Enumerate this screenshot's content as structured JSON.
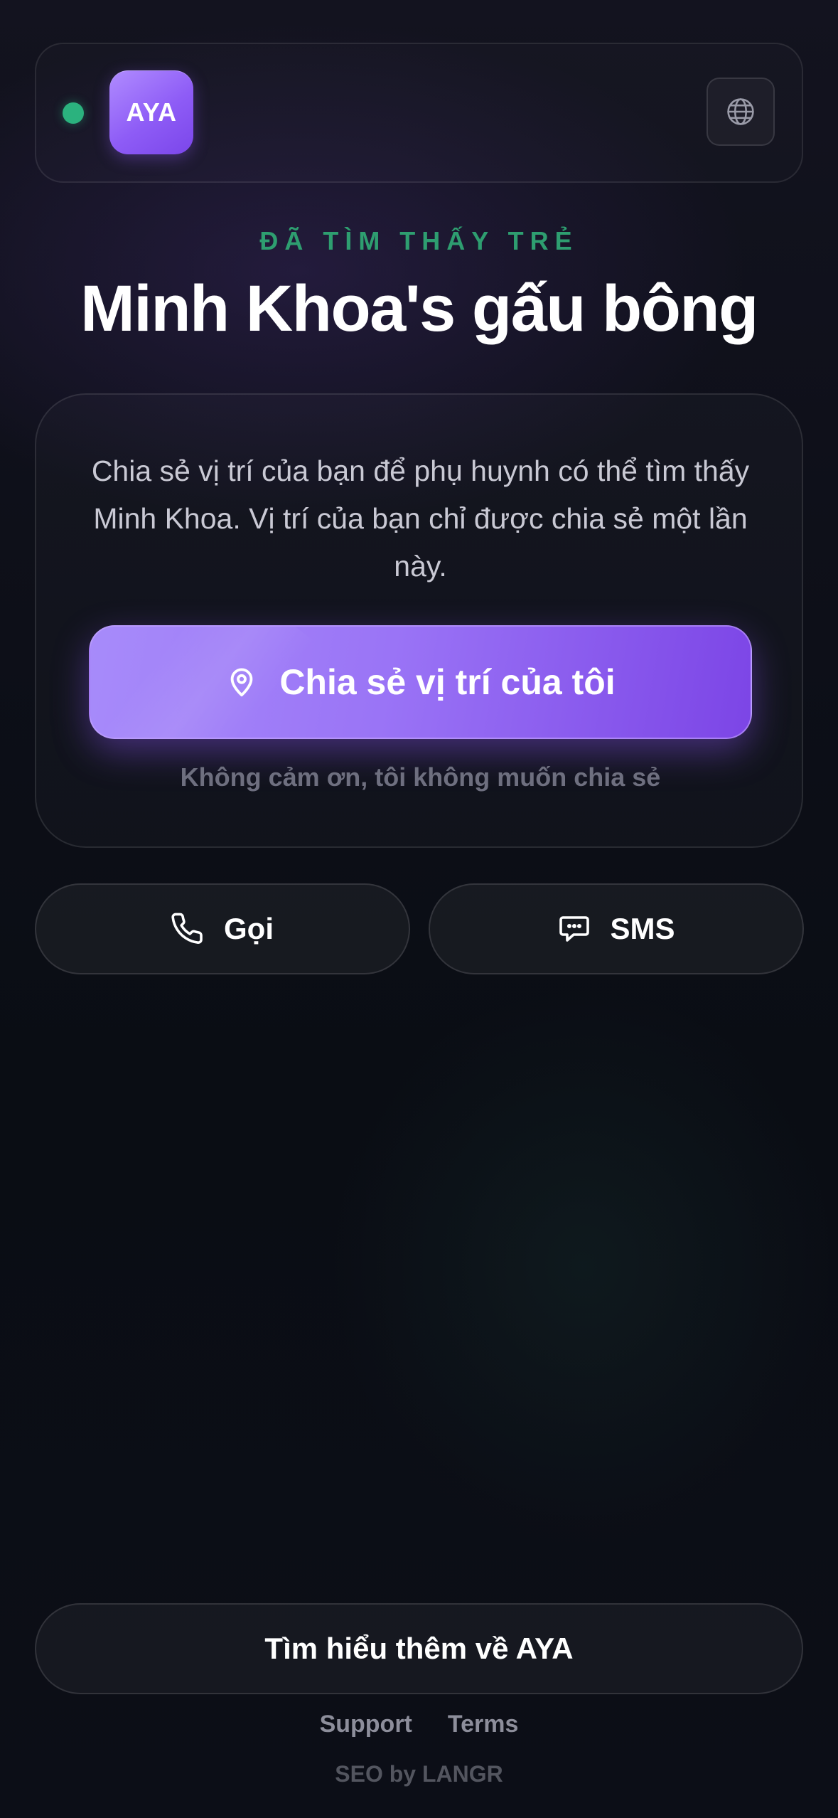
{
  "header": {
    "logo_text": "AYA",
    "status": "online",
    "status_color": "#2bb27e",
    "language_icon": "globe-icon"
  },
  "eyebrow": "ĐÃ TÌM THẤY TRẺ",
  "title": "Minh Khoa's gấu bông",
  "card": {
    "description": "Chia sẻ vị trí của bạn để phụ huynh có thể tìm thấy Minh Khoa. Vị trí của bạn chỉ được chia sẻ một lần này.",
    "share_button_icon": "location-pin-icon",
    "share_button_label": "Chia sẻ vị trí của tôi",
    "decline_label": "Không cảm ơn, tôi không muốn chia sẻ"
  },
  "actions": {
    "call_icon": "phone-icon",
    "call_label": "Gọi",
    "sms_icon": "message-icon",
    "sms_label": "SMS"
  },
  "footer": {
    "learn_more_label": "Tìm hiểu thêm về AYA",
    "links": [
      "Support",
      "Terms"
    ],
    "seo_text": "SEO by LANGR"
  },
  "colors": {
    "accent": "#8e5cf6",
    "eyebrow": "#2e9e70",
    "background": "#0d0f18"
  }
}
